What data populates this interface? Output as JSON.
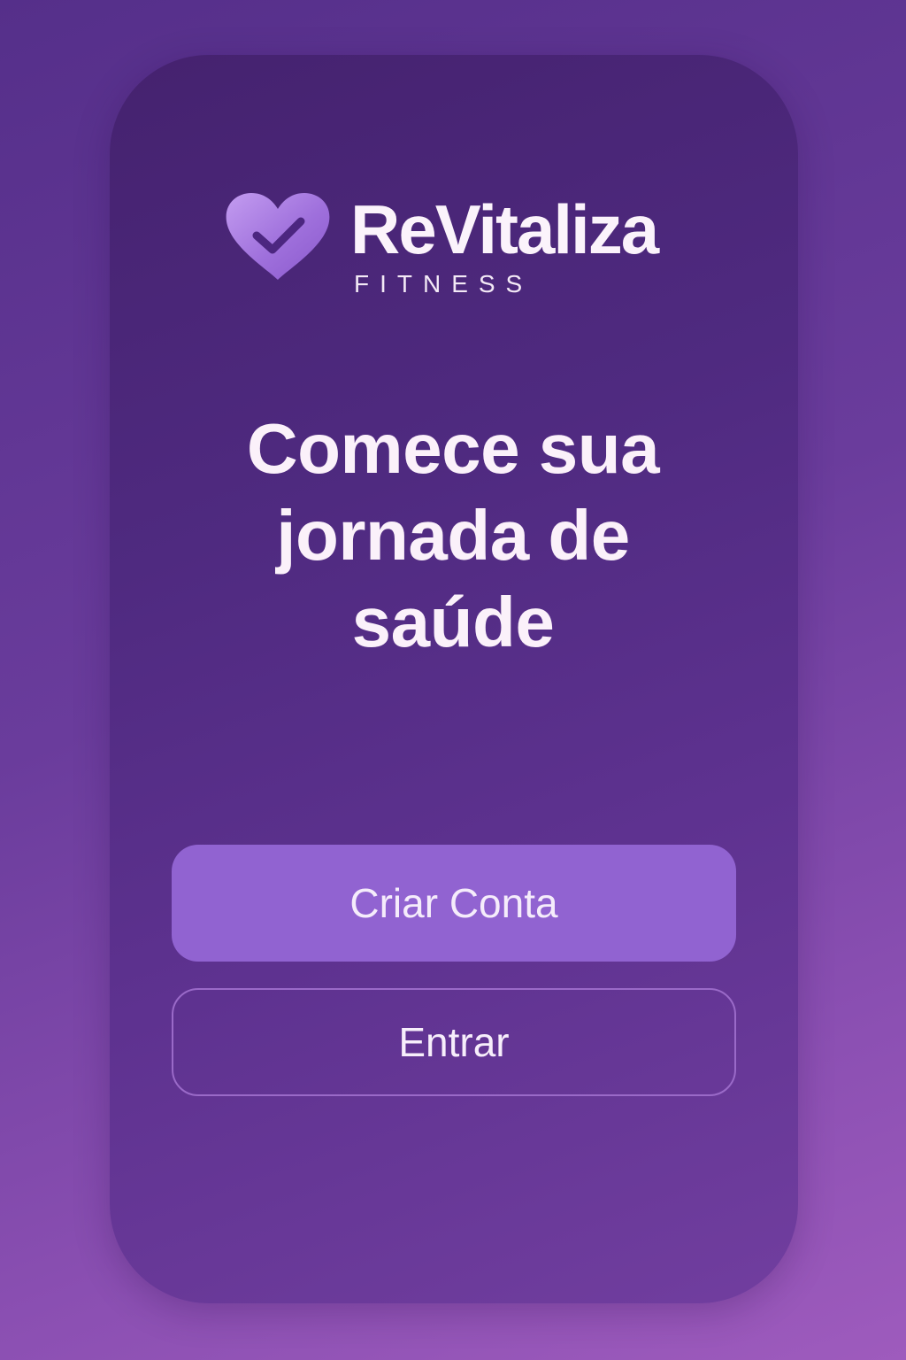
{
  "brand": {
    "name": "ReVitaliza",
    "subtitle": "FITNESS",
    "logo_icon": "heart-check-icon"
  },
  "hero": {
    "headline": "Comece sua jornada de saúde"
  },
  "actions": {
    "primary_label": "Criar Conta",
    "secondary_label": "Entrar"
  },
  "colors": {
    "background_top": "#552f8a",
    "background_bottom": "#9e5bbd",
    "card": "#4f2a80",
    "primary_button": "#9163d1",
    "secondary_border": "#9a6ac8",
    "text": "#fbf1fa",
    "logo_heart": "#a77be0"
  }
}
